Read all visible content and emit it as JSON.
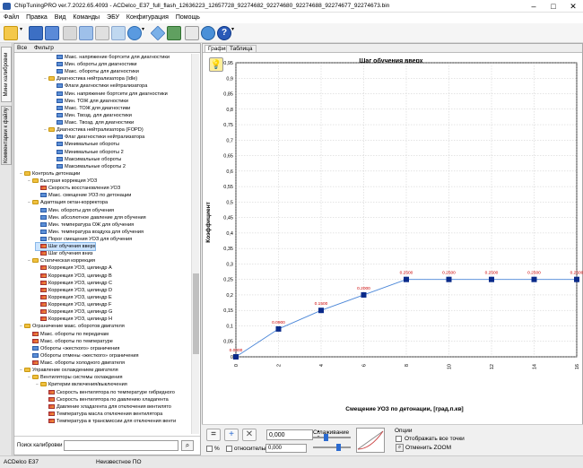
{
  "window": {
    "title": "ChipTuningPRO ver.7.2022.65.4093 - ACDelco_E37_full_flash_12636223_12657728_92274682_92274680_92274688_92274677_92274673.bin"
  },
  "menu": [
    "Файл",
    "Правка",
    "Вид",
    "Команды",
    "ЭБУ",
    "Конфигурация",
    "Помощь"
  ],
  "side_tabs": {
    "tab1": "Мини калибровки",
    "tab2": "Комментарии к файлу"
  },
  "tree_tabs": {
    "all": "Все",
    "filter": "Фильтр"
  },
  "tree": [
    {
      "label": "Макс. напряжение бортсети для диагностики",
      "indent": 5,
      "icon": "param"
    },
    {
      "label": "Мин. обороты для диагностики",
      "indent": 5,
      "icon": "param"
    },
    {
      "label": "Макс. обороты для диагностики",
      "indent": 5,
      "icon": "param"
    },
    {
      "label": "Диагностика нейтрализатора (Idle)",
      "indent": 4,
      "icon": "folder",
      "exp": "-"
    },
    {
      "label": "Флаги диагностики нейтрализатора",
      "indent": 5,
      "icon": "param"
    },
    {
      "label": "Мин. напряжение бортсети для диагностики",
      "indent": 5,
      "icon": "param"
    },
    {
      "label": "Мин. ТОЖ для диагностики",
      "indent": 5,
      "icon": "param"
    },
    {
      "label": "Макс. ТОЖ для диагностики",
      "indent": 5,
      "icon": "param"
    },
    {
      "label": "Мин. Твозд. для диагностики",
      "indent": 5,
      "icon": "param"
    },
    {
      "label": "Макс. Твозд. для диагностики",
      "indent": 5,
      "icon": "param"
    },
    {
      "label": "Диагностика нейтрализатора (FOPD)",
      "indent": 4,
      "icon": "folder",
      "exp": "-"
    },
    {
      "label": "Флаг диагностики нейтрализатора",
      "indent": 5,
      "icon": "param"
    },
    {
      "label": "Минимальные обороты",
      "indent": 5,
      "icon": "param"
    },
    {
      "label": "Минимальные обороты 2",
      "indent": 5,
      "icon": "param"
    },
    {
      "label": "Максимальные обороты",
      "indent": 5,
      "icon": "param"
    },
    {
      "label": "Максимальные обороты 2",
      "indent": 5,
      "icon": "param"
    },
    {
      "label": "Контроль детонации",
      "indent": 1,
      "icon": "folder",
      "exp": "-"
    },
    {
      "label": "Быстрая коррекция УОЗ",
      "indent": 2,
      "icon": "folder",
      "exp": "-"
    },
    {
      "label": "Скорость восстановления УОЗ",
      "indent": 3,
      "icon": "map3d"
    },
    {
      "label": "Макс. смещение УОЗ по детонации",
      "indent": 3,
      "icon": "param"
    },
    {
      "label": "Адаптация октан-корректора",
      "indent": 2,
      "icon": "folder",
      "exp": "-"
    },
    {
      "label": "Мин. обороты для обучения",
      "indent": 3,
      "icon": "param"
    },
    {
      "label": "Мин. абсолютное давление для обучения",
      "indent": 3,
      "icon": "param"
    },
    {
      "label": "Мин. температура ОЖ для обучения",
      "indent": 3,
      "icon": "param"
    },
    {
      "label": "Мин. температура воздуха для обучения",
      "indent": 3,
      "icon": "param"
    },
    {
      "label": "Порог смещения УОЗ для обучения",
      "indent": 3,
      "icon": "param"
    },
    {
      "label": "Шаг обучения вверх",
      "indent": 3,
      "icon": "map3d",
      "selected": true
    },
    {
      "label": "Шаг обучения вниз",
      "indent": 3,
      "icon": "map3d"
    },
    {
      "label": "Статическая коррекция",
      "indent": 2,
      "icon": "folder",
      "exp": "-"
    },
    {
      "label": "Коррекция УОЗ, цилиндр A",
      "indent": 3,
      "icon": "map3d"
    },
    {
      "label": "Коррекция УОЗ, цилиндр B",
      "indent": 3,
      "icon": "map3d"
    },
    {
      "label": "Коррекция УОЗ, цилиндр C",
      "indent": 3,
      "icon": "map3d"
    },
    {
      "label": "Коррекция УОЗ, цилиндр D",
      "indent": 3,
      "icon": "map3d"
    },
    {
      "label": "Коррекция УОЗ, цилиндр E",
      "indent": 3,
      "icon": "map3d"
    },
    {
      "label": "Коррекция УОЗ, цилиндр F",
      "indent": 3,
      "icon": "map3d"
    },
    {
      "label": "Коррекция УОЗ, цилиндр G",
      "indent": 3,
      "icon": "map3d"
    },
    {
      "label": "Коррекция УОЗ, цилиндр H",
      "indent": 3,
      "icon": "map3d"
    },
    {
      "label": "Ограничение макс. оборотов двигателя",
      "indent": 1,
      "icon": "folder",
      "exp": "-"
    },
    {
      "label": "Макс. обороты по передачам",
      "indent": 2,
      "icon": "map3d"
    },
    {
      "label": "Макс. обороты по температуре",
      "indent": 2,
      "icon": "map3d"
    },
    {
      "label": "Обороты «жесткого» ограничения",
      "indent": 2,
      "icon": "param"
    },
    {
      "label": "Обороты отмены «жесткого» ограничения",
      "indent": 2,
      "icon": "param"
    },
    {
      "label": "Макс. обороты холодного двигателя",
      "indent": 2,
      "icon": "map3d"
    },
    {
      "label": "Управление охлаждением двигателя",
      "indent": 1,
      "icon": "folder",
      "exp": "-"
    },
    {
      "label": "Вентиляторы системы охлаждения",
      "indent": 2,
      "icon": "folder",
      "exp": "-"
    },
    {
      "label": "Критерии включения/выключения",
      "indent": 3,
      "icon": "folder",
      "exp": "-"
    },
    {
      "label": "Скорость вентилятора по температуре гибридного",
      "indent": 4,
      "icon": "map3d"
    },
    {
      "label": "Скорость вентилятора по давлению хладагента",
      "indent": 4,
      "icon": "map3d"
    },
    {
      "label": "Давление хладагента для отключения вентилято",
      "indent": 4,
      "icon": "map3d"
    },
    {
      "label": "Температура масла отключения вентилятора",
      "indent": 4,
      "icon": "map3d"
    },
    {
      "label": "Температура в трансмиссии для отключения венти",
      "indent": 4,
      "icon": "map3d"
    }
  ],
  "search": {
    "label": "Поиск калибровки"
  },
  "right_tabs": {
    "graph": "График",
    "table": "Таблица"
  },
  "chart_data": {
    "type": "line",
    "title": "Шаг обучения вверх",
    "xlabel": "Смещение УОЗ по детонации, [град.п.кв]",
    "ylabel": "Коэффициент",
    "x": [
      0,
      2,
      4,
      6,
      8,
      10,
      12,
      14,
      16
    ],
    "values": [
      0.0,
      0.09,
      0.15,
      0.2,
      0.25,
      0.25,
      0.25,
      0.25,
      0.25
    ],
    "point_labels": [
      "0.0000",
      "0.0900",
      "0.1500",
      "0.2000",
      "0.2500",
      "0.2500",
      "0.2500",
      "0.2500",
      "0.2500"
    ],
    "xlim": [
      0,
      16
    ],
    "ylim": [
      0,
      0.95
    ],
    "xticks": [
      "0",
      "2",
      "4",
      "6",
      "8",
      "10",
      "12",
      "14",
      "16"
    ],
    "yticks": [
      "0",
      "0,05",
      "0,1",
      "0,15",
      "0,2",
      "0,25",
      "0,3",
      "0,35",
      "0,4",
      "0,45",
      "0,5",
      "0,55",
      "0,6",
      "0,65",
      "0,7",
      "0,75",
      "0,8",
      "0,85",
      "0,9",
      "0,95"
    ],
    "grid": true,
    "line_color": "#4a86d8",
    "marker_color": "#0a2a8a",
    "label_color": "#cc0000"
  },
  "bottom": {
    "value1": "0,000",
    "value2": "0,000",
    "percent_label": "%",
    "relative_label": "относительно",
    "smoothing_label": "Сглаживание",
    "options_label": "Опции",
    "show_all_points": "Отображать все точки",
    "cancel_zoom": "Отменить ZOOM"
  },
  "status": {
    "ecu": "ACDelco E37",
    "software": "Неизвестное ПО"
  }
}
